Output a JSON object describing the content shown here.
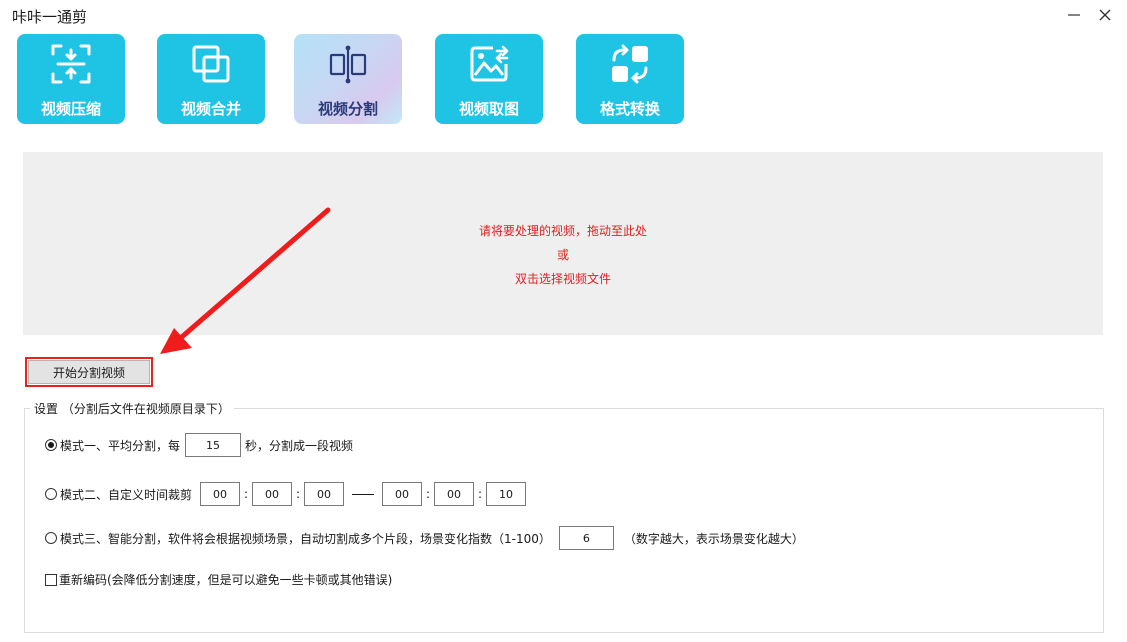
{
  "window": {
    "title": "咔咔一通剪"
  },
  "toolbar": {
    "tools": [
      {
        "label": "视频压缩",
        "icon": "compress-icon"
      },
      {
        "label": "视频合并",
        "icon": "merge-icon"
      },
      {
        "label": "视频分割",
        "icon": "split-icon",
        "active": true
      },
      {
        "label": "视频取图",
        "icon": "image-capture-icon"
      },
      {
        "label": "格式转换",
        "icon": "format-convert-icon"
      }
    ]
  },
  "drop_zone": {
    "line1": "请将要处理的视频，拖动至此处",
    "line2": "或",
    "line3": "双击选择视频文件"
  },
  "start_button": {
    "label": "开始分割视频"
  },
  "colors": {
    "accent": "#1fc3e3",
    "hint_text": "#e02020",
    "highlight": "#e8231e"
  },
  "settings": {
    "title": "设置 （分割后文件在视频原目录下）",
    "mode1": {
      "label": "模式一、平均分割，每",
      "value": "15",
      "suffix": "秒，分割成一段视频",
      "selected": true
    },
    "mode2": {
      "label": "模式二、自定义时间裁剪",
      "start": [
        "00",
        "00",
        "00"
      ],
      "end": [
        "00",
        "00",
        "10"
      ],
      "colon": ":",
      "selected": false
    },
    "mode3": {
      "label": "模式三、智能分割，软件将会根据视频场景，自动切割成多个片段，场景变化指数（1-100）",
      "value": "6",
      "note": "（数字越大，表示场景变化越大）",
      "selected": false
    },
    "reencode": {
      "label": "重新编码(会降低分割速度，但是可以避免一些卡顿或其他错误)",
      "checked": false
    }
  }
}
